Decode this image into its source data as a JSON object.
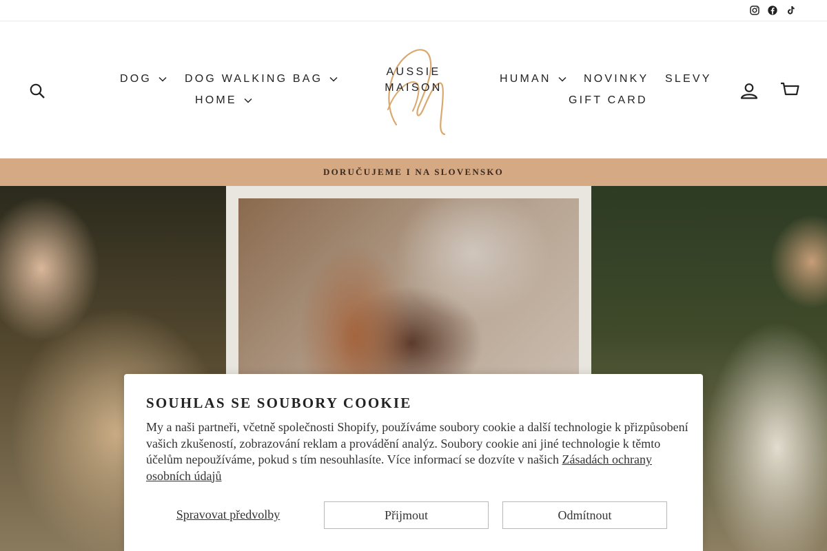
{
  "social": {
    "instagram": "Instagram",
    "facebook": "Facebook",
    "tiktok": "TikTok"
  },
  "header": {
    "search_label": "Search",
    "account_label": "Log in",
    "cart_label": "Cart",
    "logo": {
      "line1": "AUSSIE",
      "line2": "MAISON"
    },
    "nav_left": [
      {
        "label": "DOG"
      },
      {
        "label": "DOG WALKING BAG"
      },
      {
        "label": "HOME"
      }
    ],
    "nav_right": [
      {
        "label": "HUMAN"
      },
      {
        "label": "NOVINKY"
      },
      {
        "label": "SLEVY"
      },
      {
        "label": "GIFT CARD"
      }
    ]
  },
  "announcement": {
    "text": "DORUČUJEME I NA SLOVENSKO"
  },
  "colors": {
    "announcement_bg": "#d4a983",
    "logo_accent": "#d9a86f"
  },
  "cookie": {
    "title": "SOUHLAS SE SOUBORY COOKIE",
    "body": "My a naši partneři, včetně společnosti Shopify, používáme soubory cookie a další technologie k přizpůsobení vašich zkušeností, zobrazování reklam a provádění analýz. Soubory cookie ani jiné technologie k těmto účelům nepoužíváme, pokud s tím nesouhlasíte. Více informací se dozvíte v našich ",
    "privacy_link": "Zásadách ochrany osobních údajů",
    "manage": "Spravovat předvolby",
    "accept": "Přijmout",
    "decline": "Odmítnout"
  }
}
